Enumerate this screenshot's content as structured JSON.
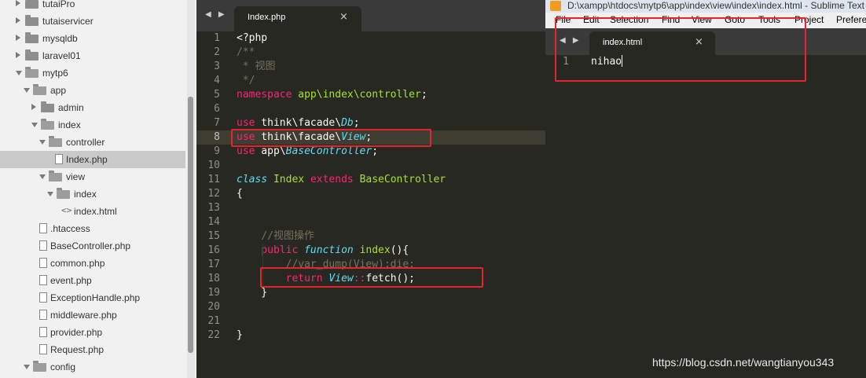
{
  "sidebar": {
    "tree": [
      {
        "label": "tutaiPro",
        "type": "folder",
        "expanded": false,
        "depth": 0
      },
      {
        "label": "tutaiservicer",
        "type": "folder",
        "expanded": false,
        "depth": 0
      },
      {
        "label": "mysqldb",
        "type": "folder",
        "expanded": false,
        "depth": 0
      },
      {
        "label": "laravel01",
        "type": "folder",
        "expanded": false,
        "depth": 0
      },
      {
        "label": "mytp6",
        "type": "folder",
        "expanded": true,
        "depth": 0
      },
      {
        "label": "app",
        "type": "folder",
        "expanded": true,
        "depth": 1
      },
      {
        "label": "admin",
        "type": "folder",
        "expanded": false,
        "depth": 2
      },
      {
        "label": "index",
        "type": "folder",
        "expanded": true,
        "depth": 2
      },
      {
        "label": "controller",
        "type": "folder",
        "expanded": true,
        "depth": 3
      },
      {
        "label": "Index.php",
        "type": "file",
        "selected": true,
        "depth": 4
      },
      {
        "label": "view",
        "type": "folder",
        "expanded": true,
        "depth": 3
      },
      {
        "label": "index",
        "type": "folder",
        "expanded": true,
        "depth": 4
      },
      {
        "label": "index.html",
        "type": "html",
        "depth": 5
      },
      {
        "label": ".htaccess",
        "type": "file",
        "depth": 2
      },
      {
        "label": "BaseController.php",
        "type": "file",
        "depth": 2
      },
      {
        "label": "common.php",
        "type": "file",
        "depth": 2
      },
      {
        "label": "event.php",
        "type": "file",
        "depth": 2
      },
      {
        "label": "ExceptionHandle.php",
        "type": "file",
        "depth": 2
      },
      {
        "label": "middleware.php",
        "type": "file",
        "depth": 2
      },
      {
        "label": "provider.php",
        "type": "file",
        "depth": 2
      },
      {
        "label": "Request.php",
        "type": "file",
        "depth": 2
      },
      {
        "label": "config",
        "type": "folder",
        "expanded": true,
        "depth": 1
      }
    ]
  },
  "left_editor": {
    "nav_arrows": "◀ ▶",
    "tab_title": "Index.php",
    "tab_close": "×",
    "active_line": 8,
    "lines": [
      [
        {
          "t": "<?php",
          "c": ""
        }
      ],
      [
        {
          "t": "/**",
          "c": "cm"
        }
      ],
      [
        {
          "t": " * 视图",
          "c": "cm"
        }
      ],
      [
        {
          "t": " */",
          "c": "cm"
        }
      ],
      [
        {
          "t": "namespace",
          "c": "kw"
        },
        {
          "t": " ",
          "c": ""
        },
        {
          "t": "app\\index\\controller",
          "c": "cls"
        },
        {
          "t": ";",
          "c": ""
        }
      ],
      [],
      [
        {
          "t": "use",
          "c": "kw"
        },
        {
          "t": " think\\facade\\",
          "c": ""
        },
        {
          "t": "Db",
          "c": "it"
        },
        {
          "t": ";",
          "c": ""
        }
      ],
      [
        {
          "t": "use",
          "c": "kw"
        },
        {
          "t": " think\\facade\\",
          "c": ""
        },
        {
          "t": "View",
          "c": "it"
        },
        {
          "t": ";",
          "c": ""
        }
      ],
      [
        {
          "t": "use",
          "c": "kw"
        },
        {
          "t": " app\\",
          "c": ""
        },
        {
          "t": "BaseController",
          "c": "it"
        },
        {
          "t": ";",
          "c": ""
        }
      ],
      [],
      [
        {
          "t": "class",
          "c": "it"
        },
        {
          "t": " ",
          "c": ""
        },
        {
          "t": "Index",
          "c": "cls"
        },
        {
          "t": " ",
          "c": ""
        },
        {
          "t": "extends",
          "c": "kw"
        },
        {
          "t": " ",
          "c": ""
        },
        {
          "t": "BaseController",
          "c": "cls"
        }
      ],
      [
        {
          "t": "{",
          "c": ""
        }
      ],
      [],
      [],
      [
        {
          "t": "    ",
          "c": ""
        },
        {
          "t": "//视图操作",
          "c": "cm"
        }
      ],
      [
        {
          "t": "    ",
          "c": ""
        },
        {
          "t": "public",
          "c": "kw"
        },
        {
          "t": " ",
          "c": ""
        },
        {
          "t": "function",
          "c": "it"
        },
        {
          "t": " ",
          "c": ""
        },
        {
          "t": "index",
          "c": "fn"
        },
        {
          "t": "(){",
          "c": ""
        }
      ],
      [
        {
          "t": "        ",
          "c": ""
        },
        {
          "t": "//var_dump(View);die;",
          "c": "cm"
        }
      ],
      [
        {
          "t": "        ",
          "c": ""
        },
        {
          "t": "return",
          "c": "kw"
        },
        {
          "t": " ",
          "c": ""
        },
        {
          "t": "View",
          "c": "it"
        },
        {
          "t": "::",
          "c": "op"
        },
        {
          "t": "fetch",
          "c": ""
        },
        {
          "t": "();",
          "c": ""
        }
      ],
      [
        {
          "t": "    }",
          "c": ""
        }
      ],
      [],
      [],
      [
        {
          "t": "}",
          "c": ""
        }
      ]
    ]
  },
  "right_window": {
    "title": "D:\\xampp\\htdocs\\mytp6\\app\\index\\view\\index\\index.html - Sublime Text",
    "menu": [
      "File",
      "Edit",
      "Selection",
      "Find",
      "View",
      "Goto",
      "Tools",
      "Project",
      "Preferences"
    ],
    "nav_arrows": "◀ ▶",
    "tab_title": "index.html",
    "tab_close": "×",
    "lines": [
      "nihao"
    ]
  },
  "watermark": "https://blog.csdn.net/wangtianyou343",
  "colors": {
    "editor_bg": "#272822",
    "keyword": "#f92672",
    "italic_type": "#66d9ef",
    "class_name": "#a6e22e",
    "comment": "#75715e",
    "highlight_box": "#e3262d"
  }
}
